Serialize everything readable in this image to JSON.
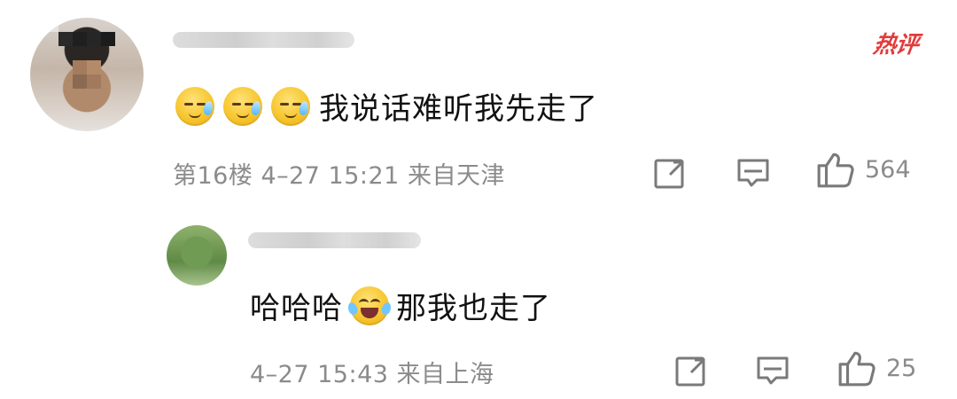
{
  "badge": {
    "text": "热评"
  },
  "comment": {
    "text": "我说话难听我先走了",
    "emoji_names": [
      "cold-sweat-emoji",
      "cold-sweat-emoji",
      "cold-sweat-emoji"
    ],
    "meta": "第16楼  4–27 15:21  来自天津",
    "likes": "564"
  },
  "reply": {
    "text_before": "哈哈哈",
    "text_after": "那我也走了",
    "emoji_name": "laughing-crying-emoji",
    "meta": "4–27 15:43  来自上海",
    "likes": "25"
  },
  "icons": {
    "share": "share-icon",
    "comment": "comment-icon",
    "like": "like-icon"
  },
  "colors": {
    "accent": "#E23B3B",
    "meta_gray": "#8B8B8B",
    "icon_gray": "#7A7A7A"
  }
}
